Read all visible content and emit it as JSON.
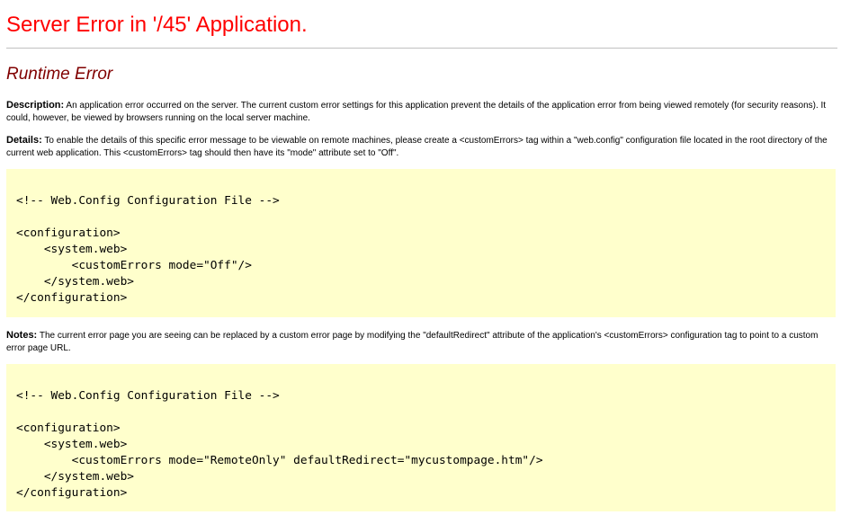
{
  "page": {
    "title": "Server Error in '/45' Application.",
    "subtitle": "Runtime Error"
  },
  "description": {
    "label": "Description:",
    "text": "An application error occurred on the server. The current custom error settings for this application prevent the details of the application error from being viewed remotely (for security reasons). It could, however, be viewed by browsers running on the local server machine."
  },
  "details": {
    "label": "Details:",
    "text": "To enable the details of this specific error message to be viewable on remote machines, please create a <customErrors> tag within a \"web.config\" configuration file located in the root directory of the current web application. This <customErrors> tag should then have its \"mode\" attribute set to \"Off\"."
  },
  "code1": {
    "text": "<!-- Web.Config Configuration File -->\n\n<configuration>\n    <system.web>\n        <customErrors mode=\"Off\"/>\n    </system.web>\n</configuration>"
  },
  "notes": {
    "label": "Notes:",
    "text": "The current error page you are seeing can be replaced by a custom error page by modifying the \"defaultRedirect\" attribute of the application's <customErrors> configuration tag to point to a custom error page URL."
  },
  "code2": {
    "text": "<!-- Web.Config Configuration File -->\n\n<configuration>\n    <system.web>\n        <customErrors mode=\"RemoteOnly\" defaultRedirect=\"mycustompage.htm\"/>\n    </system.web>\n</configuration>"
  },
  "colors": {
    "title": "#ff0000",
    "subtitle": "#800000",
    "code_background": "#ffffcc",
    "rule": "#c0c0c0"
  }
}
